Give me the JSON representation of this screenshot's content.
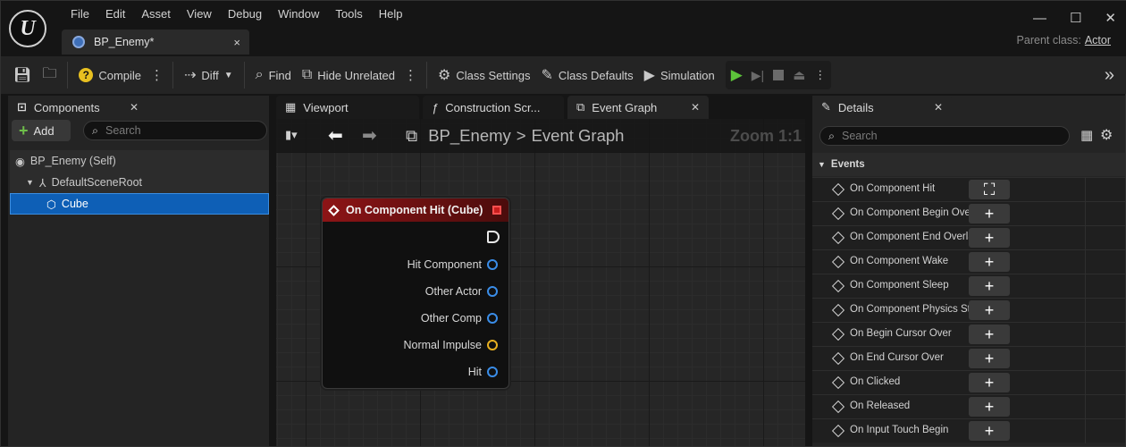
{
  "menu": [
    "File",
    "Edit",
    "Asset",
    "View",
    "Debug",
    "Window",
    "Tools",
    "Help"
  ],
  "doc_tab": {
    "label": "BP_Enemy*",
    "close": "×"
  },
  "window_controls": {
    "min": "—",
    "max": "☐",
    "close": "✕"
  },
  "parent_class": {
    "label": "Parent class:",
    "value": "Actor"
  },
  "toolbar": {
    "compile": "Compile",
    "diff": "Diff",
    "find": "Find",
    "hide_unrelated": "Hide Unrelated",
    "class_settings": "Class Settings",
    "class_defaults": "Class Defaults",
    "simulation": "Simulation"
  },
  "left_panel": {
    "tab": "Components",
    "add": "Add",
    "search_placeholder": "Search",
    "tree": [
      {
        "label": "BP_Enemy (Self)"
      },
      {
        "label": "DefaultSceneRoot"
      },
      {
        "label": "Cube"
      }
    ]
  },
  "center_tabs": [
    {
      "label": "Viewport"
    },
    {
      "label": "Construction Scr..."
    },
    {
      "label": "Event Graph"
    }
  ],
  "graph": {
    "breadcrumb_root": "BP_Enemy",
    "breadcrumb_sep": ">",
    "breadcrumb_page": "Event Graph",
    "zoom": "Zoom 1:1",
    "node": {
      "title": "On Component Hit (Cube)",
      "pins": [
        {
          "label": "Hit Component",
          "color": "#3a8de8"
        },
        {
          "label": "Other Actor",
          "color": "#3a8de8"
        },
        {
          "label": "Other Comp",
          "color": "#3a8de8"
        },
        {
          "label": "Normal Impulse",
          "color": "#e8b020"
        },
        {
          "label": "Hit",
          "color": "#3a8de8"
        }
      ]
    }
  },
  "details": {
    "tab": "Details",
    "search_placeholder": "Search",
    "section": "Events",
    "events": [
      {
        "name": "On Component Hit",
        "button": "⛶"
      },
      {
        "name": "On Component Begin Overlap",
        "button": "+"
      },
      {
        "name": "On Component End Overlap",
        "button": "+"
      },
      {
        "name": "On Component Wake",
        "button": "+"
      },
      {
        "name": "On Component Sleep",
        "button": "+"
      },
      {
        "name": "On Component Physics State Change",
        "button": "+"
      },
      {
        "name": "On Begin Cursor Over",
        "button": "+"
      },
      {
        "name": "On End Cursor Over",
        "button": "+"
      },
      {
        "name": "On Clicked",
        "button": "+"
      },
      {
        "name": "On Released",
        "button": "+"
      },
      {
        "name": "On Input Touch Begin",
        "button": "+"
      }
    ]
  },
  "colors": {
    "accent": "#0e5fb6",
    "node_header": "#8d1416",
    "add_plus": "#6ebe4a",
    "play": "#5cc43a"
  }
}
